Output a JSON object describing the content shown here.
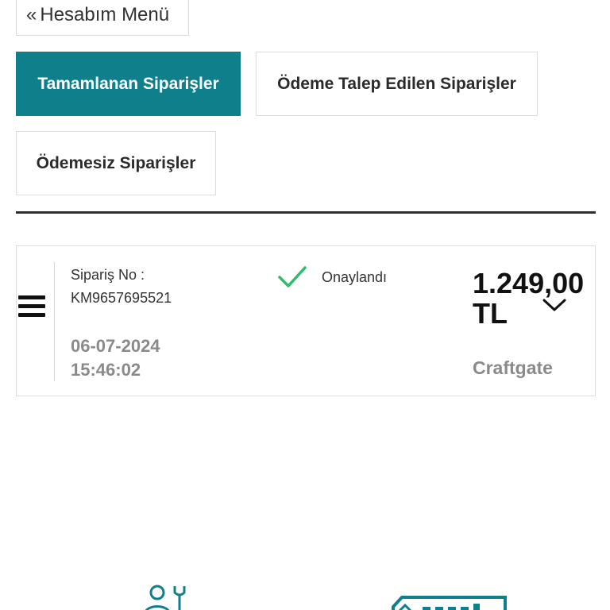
{
  "back": {
    "label": "Hesabım Menü",
    "icon": "double-chevron-left-icon"
  },
  "tabs": [
    {
      "label": "Tamamlanan Siparişler",
      "active": true
    },
    {
      "label": "Ödeme Talep Edilen Siparişler",
      "active": false
    },
    {
      "label": "Ödemesiz Siparişler",
      "active": false
    }
  ],
  "order": {
    "order_label": "Sipariş No :",
    "order_no": "KM9657695521",
    "date": "06-07-2024",
    "time": "15:46:02",
    "status": "Onaylandı",
    "amount": "1.249,00",
    "currency": "TL",
    "provider": "Craftgate"
  },
  "colors": {
    "accent": "#0f7f8c",
    "status_check": "#2ebd6b",
    "muted_text": "#8a8a8a"
  },
  "icons": {
    "menu": "hamburger-menu-icon",
    "status": "check-icon",
    "expand": "chevron-down-icon",
    "footer_support": "support-tools-icon",
    "footer_badge": "local-badge-icon"
  }
}
